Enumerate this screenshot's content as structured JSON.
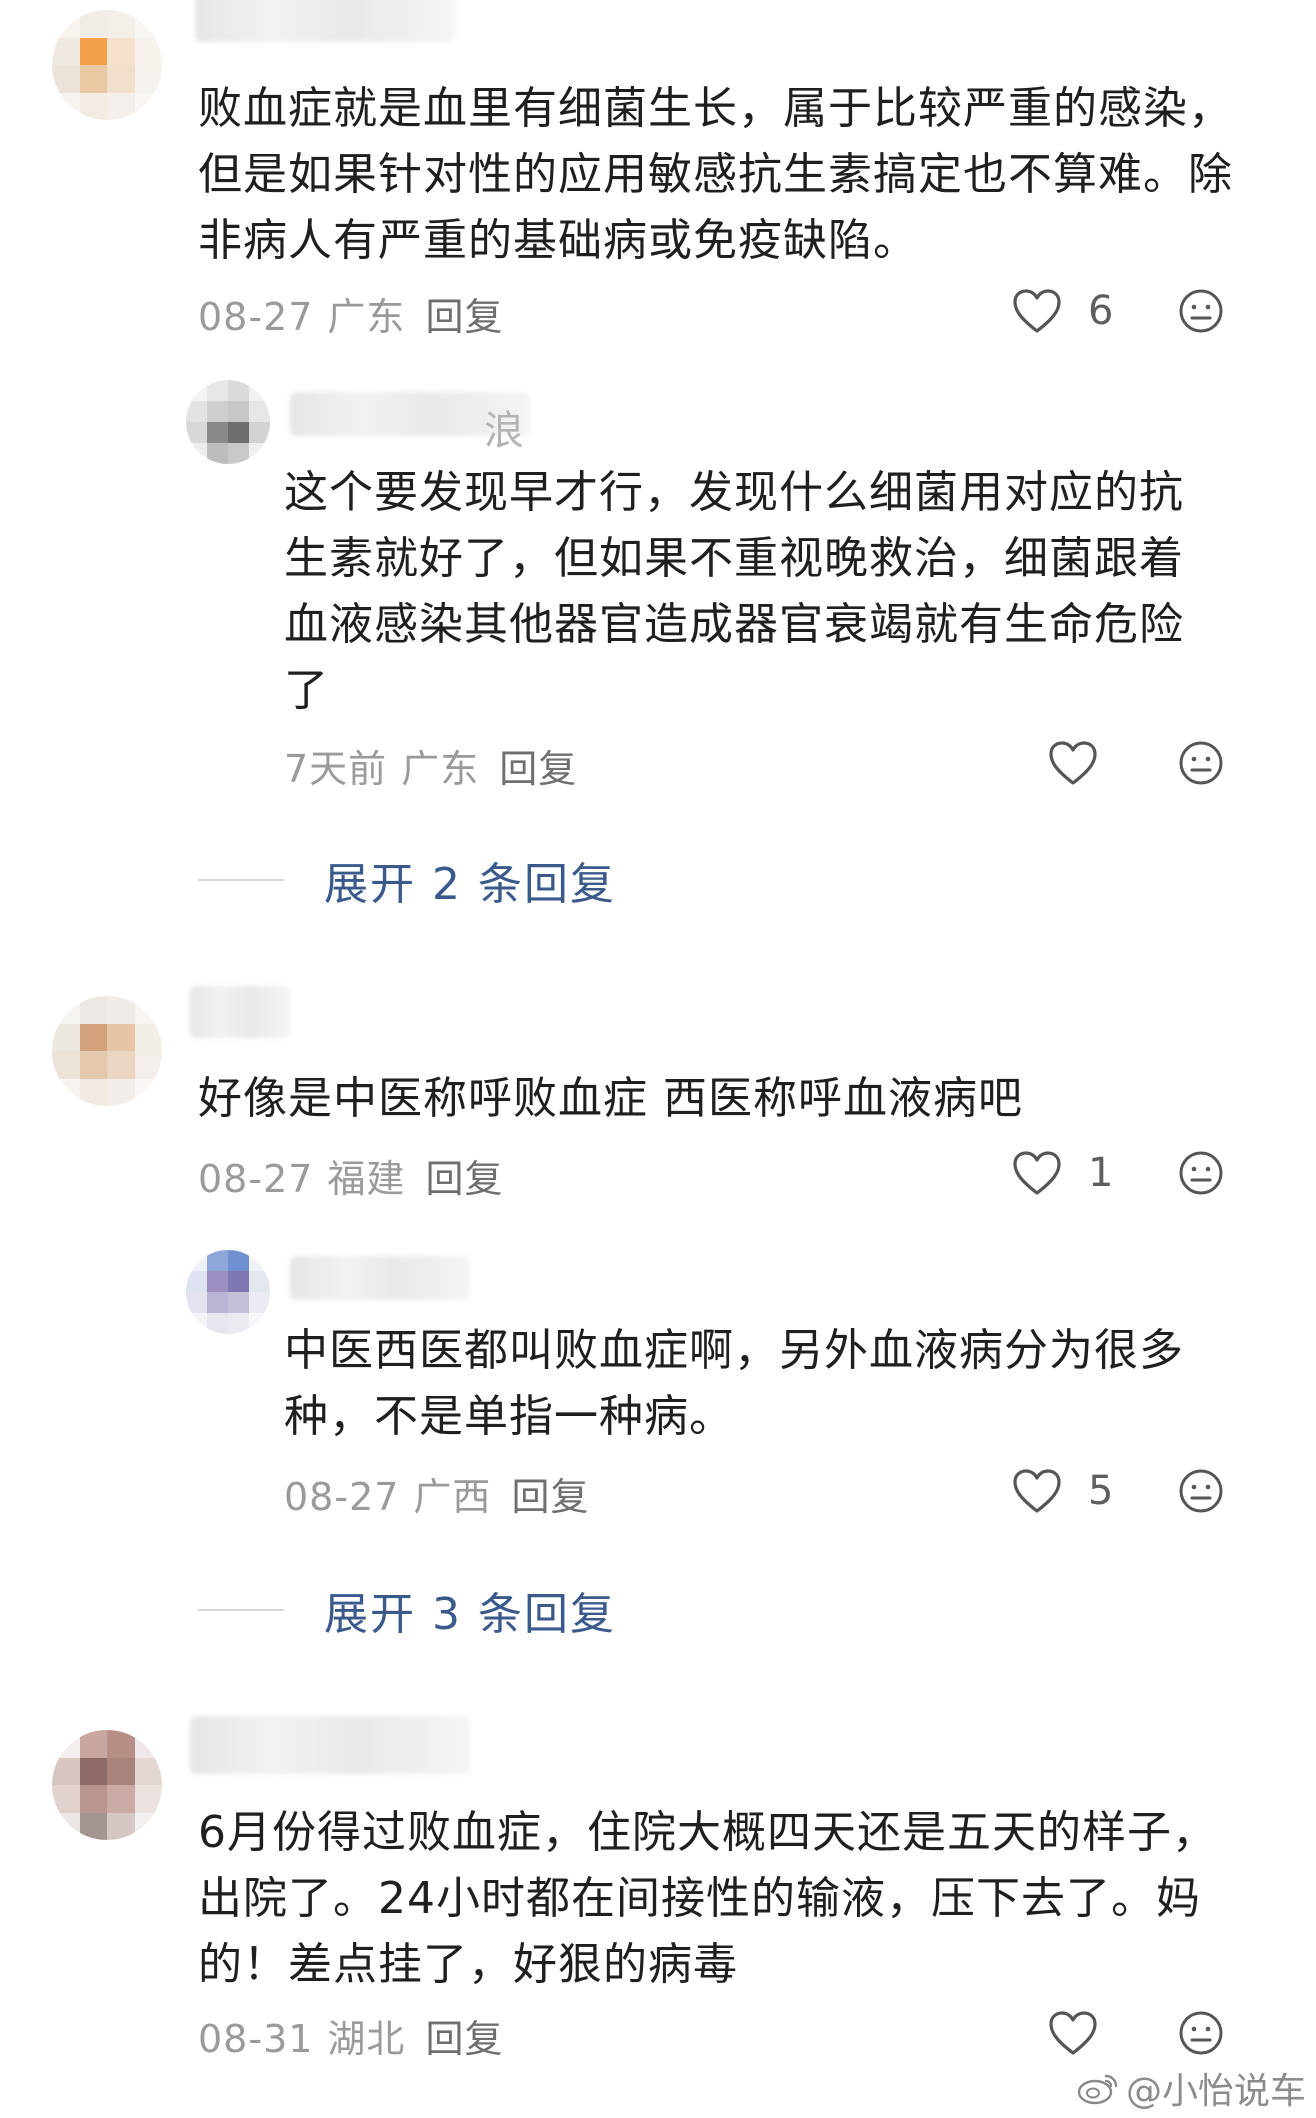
{
  "comments": [
    {
      "text": "败血症就是血里有细菌生长，属于比较严重的感染，但是如果针对性的应用敏感抗生素搞定也不算难。除非病人有严重的基础病或免疫缺陷。",
      "date": "08-27",
      "region": "广东",
      "reply_label": "回复",
      "likes": "6"
    },
    {
      "name_fragment": "浪",
      "text": "这个要发现早才行，发现什么细菌用对应的抗生素就好了，但如果不重视晚救治，细菌跟着血液感染其他器官造成器官衰竭就有生命危险了",
      "date": "7天前",
      "region": "广东",
      "reply_label": "回复",
      "likes": ""
    },
    {
      "text": "好像是中医称呼败血症  西医称呼血液病吧",
      "date": "08-27",
      "region": "福建",
      "reply_label": "回复",
      "likes": "1"
    },
    {
      "text": "中医西医都叫败血症啊，另外血液病分为很多种，不是单指一种病。",
      "date": "08-27",
      "region": "广西",
      "reply_label": "回复",
      "likes": "5"
    },
    {
      "text": "6月份得过败血症，住院大概四天还是五天的样子，出院了。24小时都在间接性的输液，压下去了。妈的！差点挂了，好狠的病毒",
      "date": "08-31",
      "region": "湖北",
      "reply_label": "回复",
      "likes": ""
    }
  ],
  "expand_links": [
    {
      "label": "展开 2 条回复"
    },
    {
      "label": "展开 3 条回复"
    }
  ],
  "watermark": "@小怡说车",
  "colors": {
    "link": "#3a5a8c",
    "meta": "#9a9a9a",
    "icon": "#555555"
  },
  "icons": [
    "heart-icon",
    "neutral-face-icon",
    "weibo-logo-icon"
  ]
}
